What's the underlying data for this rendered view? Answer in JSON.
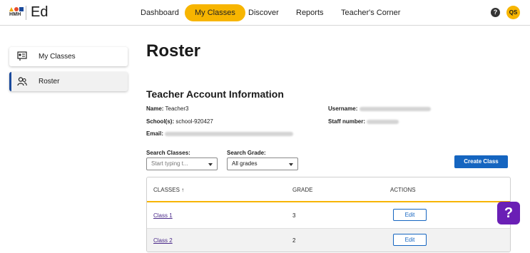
{
  "logo": {
    "brand": "HMH",
    "product": "Ed"
  },
  "nav": {
    "items": [
      {
        "label": "Dashboard",
        "active": false
      },
      {
        "label": "My Classes",
        "active": true
      },
      {
        "label": "Discover",
        "active": false
      },
      {
        "label": "Reports",
        "active": false
      },
      {
        "label": "Teacher's Corner",
        "active": false
      }
    ],
    "help_icon": "question-circle-icon",
    "avatar_initials": "QS",
    "accent": "#f7b500"
  },
  "sidebar": {
    "items": [
      {
        "label": "My Classes",
        "icon": "classroom-icon",
        "active": false
      },
      {
        "label": "Roster",
        "icon": "users-icon",
        "active": true
      }
    ]
  },
  "page": {
    "title": "Roster",
    "section_title": "Teacher Account Information",
    "name_label": "Name:",
    "name_value": "Teacher3",
    "schools_label": "School(s):",
    "schools_value": "school-920427",
    "email_label": "Email:",
    "username_label": "Username:",
    "staff_label": "Staff number:"
  },
  "filters": {
    "search_classes_label": "Search Classes:",
    "search_classes_placeholder": "Start typing t...",
    "search_grade_label": "Search Grade:",
    "search_grade_value": "All grades"
  },
  "create_class_label": "Create Class",
  "table": {
    "headers": {
      "classes": "CLASSES ↑",
      "grade": "GRADE",
      "actions": "ACTIONS"
    },
    "rows": [
      {
        "class": "Class 1",
        "grade": "3",
        "action": "Edit"
      },
      {
        "class": "Class 2",
        "grade": "2",
        "action": "Edit"
      }
    ]
  },
  "help_fab": "?",
  "colors": {
    "primary": "#1565c0",
    "accent": "#f7b500",
    "help": "#6a1fb5",
    "link": "#4b2a8a"
  }
}
